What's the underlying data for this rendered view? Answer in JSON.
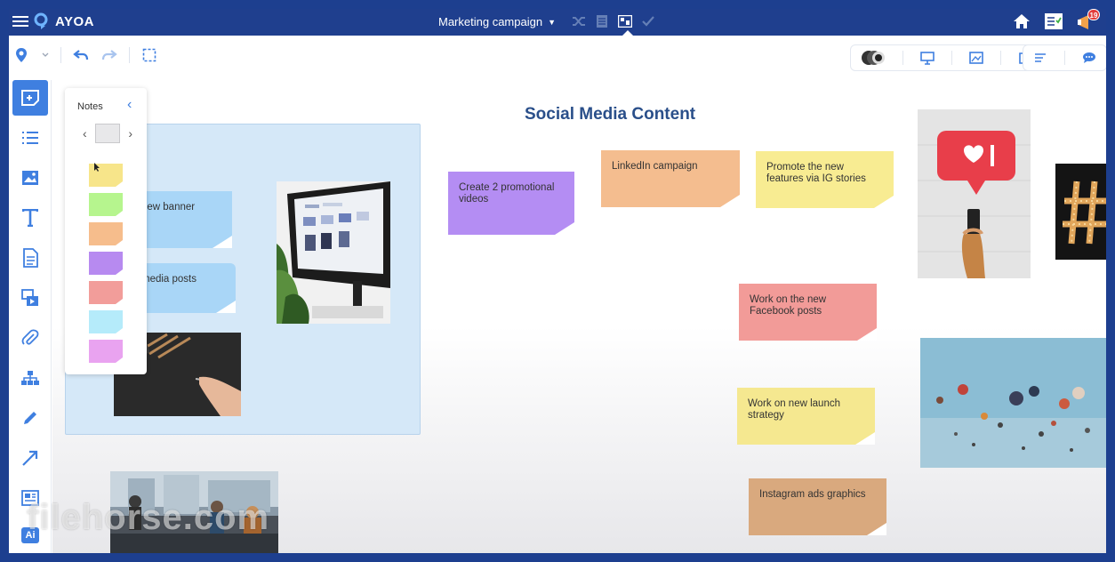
{
  "app": {
    "logo_text": "AYOA",
    "board_title": "Marketing campaign",
    "notification_count": "19"
  },
  "topbar": {
    "view_icons": [
      "shuffle-icon",
      "document-view-icon",
      "canvas-view-icon",
      "check-icon"
    ],
    "right_icons": [
      "home-icon",
      "task-list-icon",
      "notifications-icon"
    ]
  },
  "toolbar": {
    "left_icons": [
      "marker-icon",
      "chevron-down-icon",
      "undo-icon",
      "redo-icon",
      "select-area-icon"
    ],
    "right_icons": [
      "collaborators-icon",
      "present-icon",
      "image-export-icon",
      "share-icon",
      "outline-icon",
      "comments-icon"
    ]
  },
  "sidebar": {
    "items": [
      "add-note-icon",
      "list-icon",
      "image-icon",
      "text-icon",
      "document-icon",
      "media-icon",
      "attachment-icon",
      "hierarchy-icon",
      "pencil-icon",
      "arrow-icon",
      "gallery-icon",
      "ai-icon"
    ],
    "ai_label": "Ai"
  },
  "palette": {
    "title": "Notes",
    "colors": [
      "#f7e58a",
      "#b6f58e",
      "#f6bd8c",
      "#b78af0",
      "#f29d9a",
      "#b5ebfa",
      "#e9a3f0"
    ]
  },
  "canvas": {
    "heading": "Social Media Content",
    "notes": [
      {
        "text": "new banner",
        "color": "#a9d6f7"
      },
      {
        "text": "media posts",
        "color": "#a9d6f7"
      },
      {
        "text": "Create 2 promotional videos",
        "color": "#b48df3"
      },
      {
        "text": "LinkedIn campaign",
        "color": "#f4bd8f"
      },
      {
        "text": "Promote the new features via IG stories",
        "color": "#f8ec92"
      },
      {
        "text": "Work on the new Facebook posts",
        "color": "#f29b98"
      },
      {
        "text": "Work on new launch strategy",
        "color": "#f5e890"
      },
      {
        "text": "Instagram ads graphics",
        "color": "#d9a97e"
      }
    ]
  },
  "watermark": "filehorse.com"
}
